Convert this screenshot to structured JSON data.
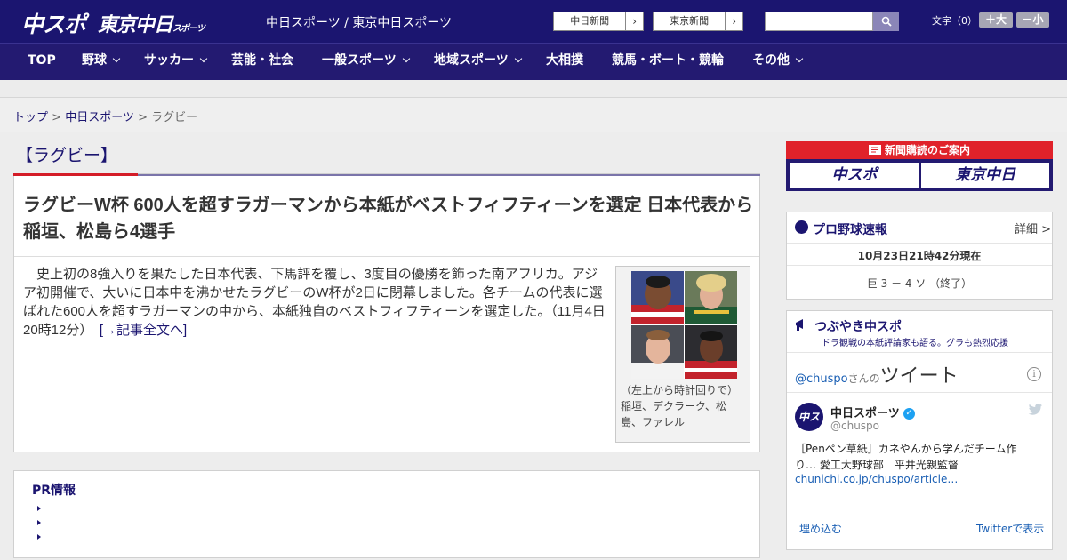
{
  "header": {
    "logo_primary": "中スポ",
    "logo_secondary": "東京中日",
    "logo_secondary_small": "スポーツ",
    "site_title": "中日スポーツ / 東京中日スポーツ",
    "paper_links": [
      {
        "label": "中日新聞",
        "arrow": "›"
      },
      {
        "label": "東京新聞",
        "arrow": "›"
      }
    ],
    "search": {
      "placeholder": ""
    },
    "font_size": {
      "label": "文字（0）",
      "bigger": "＋大",
      "smaller": "－小"
    }
  },
  "nav": {
    "items": [
      {
        "label": "TOP",
        "dropdown": false
      },
      {
        "label": "野球",
        "dropdown": true
      },
      {
        "label": "サッカー",
        "dropdown": true
      },
      {
        "label": "芸能・社会",
        "dropdown": false
      },
      {
        "label": "一般スポーツ",
        "dropdown": true
      },
      {
        "label": "地域スポーツ",
        "dropdown": true
      },
      {
        "label": "大相撲",
        "dropdown": false
      },
      {
        "label": "競馬・ボート・競輪",
        "dropdown": false
      },
      {
        "label": "その他",
        "dropdown": true
      }
    ]
  },
  "breadcrumb": {
    "items": [
      "トップ",
      "中日スポーツ",
      "ラグビー"
    ],
    "separator": ">"
  },
  "article": {
    "category": "【ラグビー】",
    "headline": "ラグビーW杯 600人を超すラガーマンから本紙がベストフィフティーンを選定 日本代表から稲垣、松島ら4選手",
    "body": "　史上初の8強入りを果たした日本代表、下馬評を覆し、3度目の優勝を飾った南アフリカ。アジア初開催で、大いに日本中を沸かせたラグビーのW杯が2日に閉幕しました。各チームの代表に選ばれた600人を超すラガーマンの中から、本紙独自のベストフィフティーンを選定した。（11月4日 20時12分）　",
    "read_more": "[→記事全文へ]",
    "photo_caption": "（左上から時計回りで）稲垣、デクラーク、松島、ファレル"
  },
  "pr": {
    "title": "PR情報"
  },
  "sidebar": {
    "subscription": {
      "title": "新聞購読のご案内",
      "buttons": [
        "中スポ",
        "東京中日"
      ]
    },
    "baseball": {
      "title": "プロ野球速報",
      "detail_link": "詳細 >",
      "updated": "10月23日21時42分現在",
      "score": "巨 3 － 4 ソ （終了）"
    },
    "twitter": {
      "title": "つぶやき中スポ",
      "subtitle": "ドラ観戦の本紙評論家も語る。グラも熱烈応援",
      "handle": "@chuspo",
      "handle_suffix": "さんの",
      "tweets_label": "ツイート",
      "account_name": "中日スポーツ",
      "account_user": "@chuspo",
      "tweet_text": "［Penペン草紙］カネやんから学んだチーム作り… 愛工大野球部　平井光親監督",
      "tweet_link": "chunichi.co.jp/chuspo/article…",
      "embed_label": "埋め込む",
      "view_label": "Twitterで表示"
    }
  },
  "colors": {
    "brand_navy": "#1b1570",
    "nav_bg": "#231a71",
    "accent_red": "#d41c27",
    "link_blue": "#1a5fb4"
  }
}
